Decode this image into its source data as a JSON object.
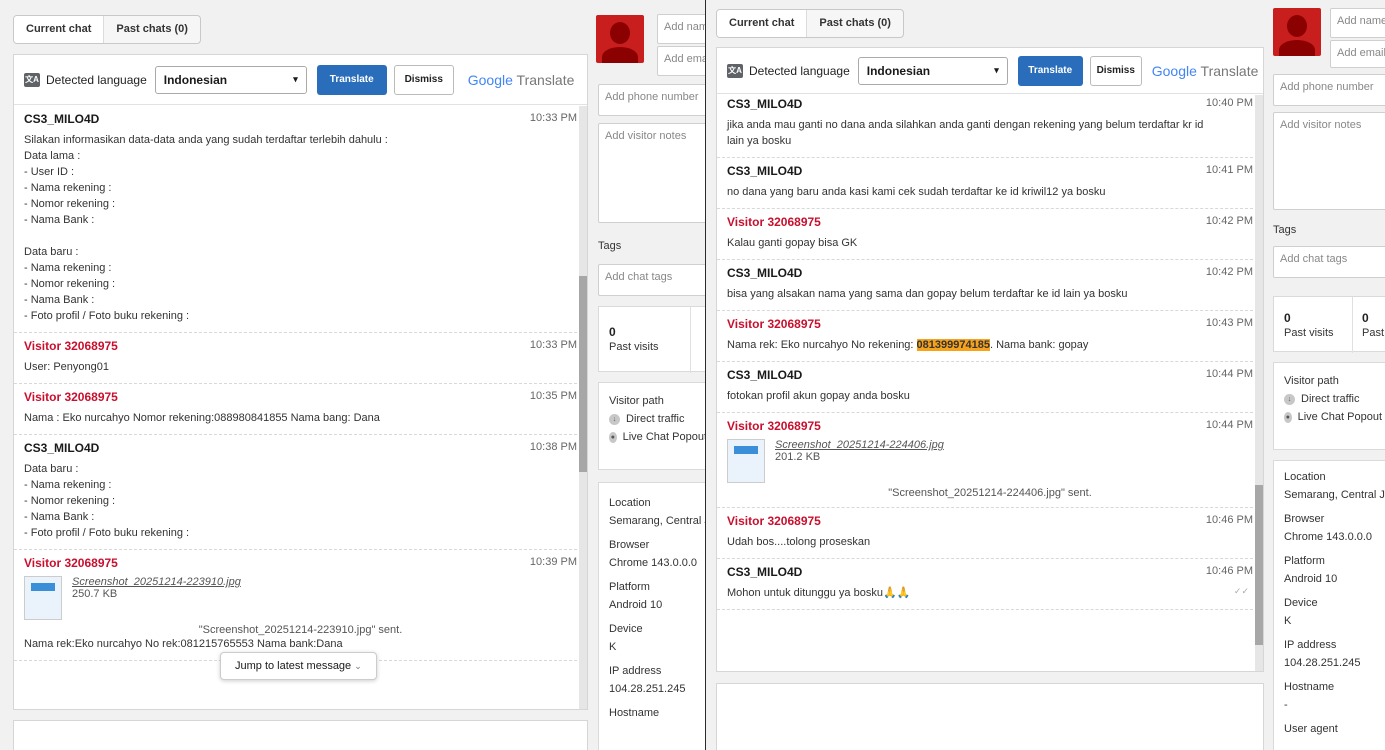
{
  "tabs": {
    "current": "Current chat",
    "past": "Past chats (0)"
  },
  "translate": {
    "detected_label": "Detected language",
    "language": "Indonesian",
    "translate_btn": "Translate",
    "dismiss_btn": "Dismiss",
    "brand_google": "Google",
    "brand_translate": "Translate"
  },
  "jump_label": "Jump to latest message",
  "side": {
    "name_placeholder": "Add name",
    "email_placeholder": "Add email",
    "phone_placeholder": "Add phone number",
    "notes_placeholder": "Add visitor notes",
    "tags_label": "Tags",
    "tags_placeholder": "Add chat tags",
    "past_visits_count": "0",
    "past_visits_label": "Past visits",
    "past_chats_count": "0",
    "past_chats_label": "Past chats",
    "visitor_path_label": "Visitor path",
    "path_items": [
      "Direct traffic",
      "Live Chat Popout"
    ],
    "info": [
      {
        "key": "Location",
        "value": "Semarang, Central Java"
      },
      {
        "key": "Browser",
        "value": "Chrome 143.0.0.0"
      },
      {
        "key": "Platform",
        "value": "Android 10"
      },
      {
        "key": "Device",
        "value": "K"
      },
      {
        "key": "IP address",
        "value": "104.28.251.245"
      },
      {
        "key": "Hostname",
        "value": "-"
      },
      {
        "key": "User agent",
        "value": ""
      }
    ]
  },
  "chat1": [
    {
      "author": "CS3_MILO4D",
      "time": "10:33 PM",
      "visitor": false,
      "text": "Silakan informasikan data-data anda yang sudah terdaftar terlebih dahulu :\nData lama :\n- User ID :\n- Nama rekening :\n- Nomor rekening :\n- Nama Bank :\n\nData baru :\n- Nama rekening :\n- Nomor rekening :\n- Nama Bank :\n- Foto profil / Foto buku rekening :"
    },
    {
      "author": "Visitor 32068975",
      "time": "10:33 PM",
      "visitor": true,
      "text": "User: Penyong01"
    },
    {
      "author": "Visitor 32068975",
      "time": "10:35 PM",
      "visitor": true,
      "text": "Nama : Eko nurcahyo Nomor rekening:088980841855 Nama bang: Dana"
    },
    {
      "author": "CS3_MILO4D",
      "time": "10:38 PM",
      "visitor": false,
      "text": "Data baru :\n- Nama rekening :\n- Nomor rekening :\n- Nama Bank :\n- Foto profil / Foto buku rekening :"
    },
    {
      "author": "Visitor 32068975",
      "time": "10:39 PM",
      "visitor": true,
      "file_name": "Screenshot_20251214-223910.jpg",
      "file_size": "250.7 KB",
      "sent": "\"Screenshot_20251214-223910.jpg\" sent.",
      "text": "Nama rek:Eko nurcahyo No rek:081215765553 Nama bank:Dana"
    }
  ],
  "chat2": [
    {
      "author": "CS3_MILO4D",
      "time": "10:40 PM",
      "visitor": false,
      "text": "jika anda mau ganti no dana anda silahkan anda ganti dengan rekening yang belum terdaftar kr id\nlain ya bosku"
    },
    {
      "author": "CS3_MILO4D",
      "time": "10:41 PM",
      "visitor": false,
      "text": "no dana yang baru anda kasi kami cek sudah terdaftar ke id kriwil12 ya bosku"
    },
    {
      "author": "Visitor 32068975",
      "time": "10:42 PM",
      "visitor": true,
      "text": "Kalau ganti gopay bisa GK"
    },
    {
      "author": "CS3_MILO4D",
      "time": "10:42 PM",
      "visitor": false,
      "text": "bisa yang alsakan nama yang sama dan gopay belum terdaftar ke id lain ya bosku"
    },
    {
      "author": "Visitor 32068975",
      "time": "10:43 PM",
      "visitor": true,
      "text_pre": "Nama rek: Eko nurcahyo No rekening: ",
      "highlight": "081399974185",
      "text_post": ". Nama bank: gopay"
    },
    {
      "author": "CS3_MILO4D",
      "time": "10:44 PM",
      "visitor": false,
      "text": "fotokan profil akun gopay anda bosku"
    },
    {
      "author": "Visitor 32068975",
      "time": "10:44 PM",
      "visitor": true,
      "file_name": "Screenshot_20251214-224406.jpg",
      "file_size": "201.2 KB",
      "sent": "\"Screenshot_20251214-224406.jpg\" sent."
    },
    {
      "author": "Visitor 32068975",
      "time": "10:46 PM",
      "visitor": true,
      "text": "Udah bos....tolong proseskan"
    },
    {
      "author": "CS3_MILO4D",
      "time": "10:46 PM",
      "visitor": false,
      "text": "Mohon untuk ditunggu ya bosku🙏🙏",
      "read": "✓✓"
    }
  ]
}
